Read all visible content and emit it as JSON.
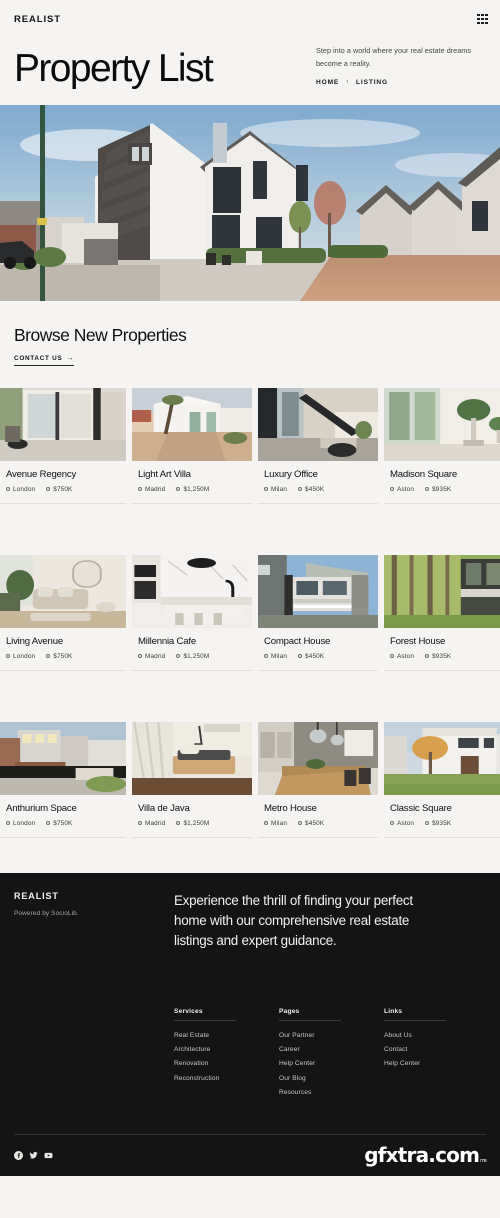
{
  "topbar": {
    "brand": "REALIST",
    "menu_icon": "grid-menu-icon"
  },
  "hero": {
    "title": "Property List",
    "subtitle": "Step into a world where your real estate dreams become a reality.",
    "breadcrumb": {
      "home": "HOME",
      "separator": "›",
      "current": "LISTING"
    }
  },
  "section": {
    "title": "Browse New Properties",
    "cta_label": "CONTACT US",
    "cta_arrow": "→"
  },
  "properties": [
    {
      "title": "Avenue Regency",
      "city": "London",
      "price": "$750K",
      "image": "modern-living-room-patio"
    },
    {
      "title": "Light Art Villa",
      "city": "Madrid",
      "price": "$1,250M",
      "image": "white-villa-courtyard"
    },
    {
      "title": "Luxury Office",
      "city": "Milan",
      "price": "$450K",
      "image": "office-staircase-interior"
    },
    {
      "title": "Madison Square",
      "city": "Aston",
      "price": "$935K",
      "image": "bright-plant-interior"
    },
    {
      "title": "Living Avenue",
      "city": "London",
      "price": "$750K",
      "image": "beige-living-room"
    },
    {
      "title": "Millennia Cafe",
      "city": "Madrid",
      "price": "$1,250M",
      "image": "marble-kitchen"
    },
    {
      "title": "Compact House",
      "city": "Milan",
      "price": "$450K",
      "image": "modular-glass-house"
    },
    {
      "title": "Forest House",
      "city": "Aston",
      "price": "$935K",
      "image": "forest-modern-building"
    },
    {
      "title": "Anthurium Space",
      "city": "London",
      "price": "$750K",
      "image": "concrete-modern-home"
    },
    {
      "title": "Villa de Java",
      "city": "Madrid",
      "price": "$1,250M",
      "image": "bedroom-curtains"
    },
    {
      "title": "Metro House",
      "city": "Milan",
      "price": "$450K",
      "image": "dining-pendant-lights"
    },
    {
      "title": "Classic Square",
      "city": "Aston",
      "price": "$935K",
      "image": "white-house-tree"
    }
  ],
  "footer": {
    "brand": "REALIST",
    "powered_by": "Powered by SocioLib.",
    "lead": "Experience the thrill of finding your perfect home with our comprehensive real estate listings and expert guidance.",
    "columns": [
      {
        "title": "Services",
        "items": [
          "Real Estate",
          "Architecture",
          "Renovation",
          "Reconstruction"
        ]
      },
      {
        "title": "Pages",
        "items": [
          "Our Partner",
          "Career",
          "Help Center",
          "Our Blog",
          "Resources"
        ]
      },
      {
        "title": "Links",
        "items": [
          "About Us",
          "Contact",
          "Help Center"
        ]
      }
    ],
    "socials": [
      "facebook-icon",
      "twitter-icon",
      "youtube-icon"
    ],
    "watermark": "gfxtra.com",
    "watermark_sup": "ms"
  }
}
